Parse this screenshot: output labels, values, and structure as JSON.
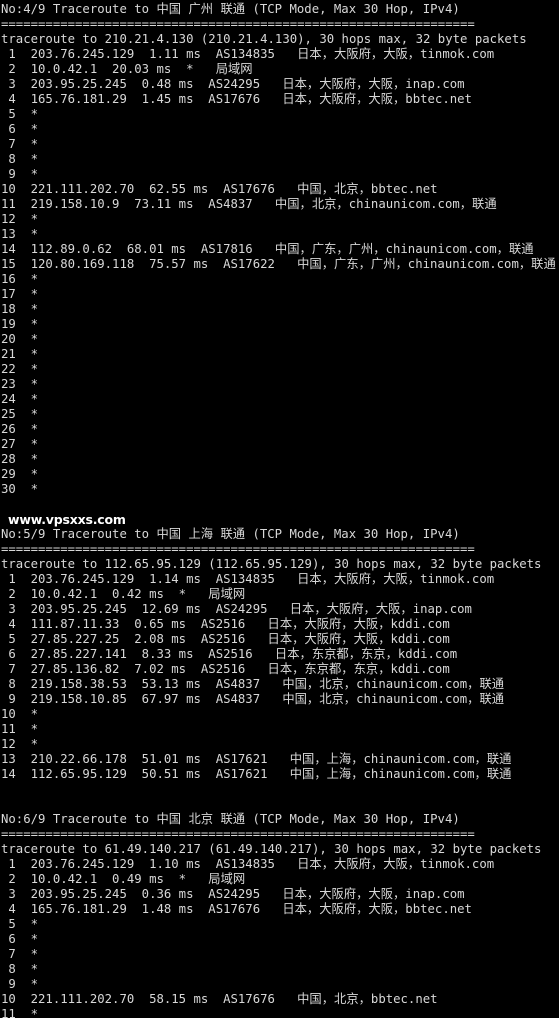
{
  "terminal": {
    "background_color": "#000000",
    "text_color": "#d8d8d8",
    "watermark": "www.vpsxxs.com",
    "separator": "================================================================"
  },
  "blocks": [
    {
      "header": "No:4/9 Traceroute to 中国 广州 联通 (TCP Mode, Max 30 Hop, IPv4)",
      "separator": "================================================================",
      "intro": "traceroute to 210.21.4.130 (210.21.4.130), 30 hops max, 32 byte packets",
      "hops": [
        " 1  203.76.245.129  1.11 ms  AS134835   日本，大阪府，大阪，tinmok.com",
        " 2  10.0.42.1  20.03 ms  *   局域网",
        " 3  203.95.25.245  0.48 ms  AS24295   日本，大阪府，大阪，inap.com",
        " 4  165.76.181.29  1.45 ms  AS17676   日本，大阪府，大阪，bbtec.net",
        " 5  *",
        " 6  *",
        " 7  *",
        " 8  *",
        " 9  *",
        "10  221.111.202.70  62.55 ms  AS17676   中国，北京，bbtec.net",
        "11  219.158.10.9  73.11 ms  AS4837   中国，北京，chinaunicom.com，联通",
        "12  *",
        "13  *",
        "14  112.89.0.62  68.01 ms  AS17816   中国，广东，广州，chinaunicom.com，联通",
        "15  120.80.169.118  75.57 ms  AS17622   中国，广东，广州，chinaunicom.com，联通",
        "16  *",
        "17  *",
        "18  *",
        "19  *",
        "20  *",
        "21  *",
        "22  *",
        "23  *",
        "24  *",
        "25  *",
        "26  *",
        "27  *",
        "28  *",
        "29  *",
        "30  *"
      ]
    },
    {
      "header": "No:5/9 Traceroute to 中国 上海 联通 (TCP Mode, Max 30 Hop, IPv4)",
      "separator": "================================================================",
      "intro": "traceroute to 112.65.95.129 (112.65.95.129), 30 hops max, 32 byte packets",
      "hops": [
        " 1  203.76.245.129  1.14 ms  AS134835   日本，大阪府，大阪，tinmok.com",
        " 2  10.0.42.1  0.42 ms  *   局域网",
        " 3  203.95.25.245  12.69 ms  AS24295   日本，大阪府，大阪，inap.com",
        " 4  111.87.11.33  0.65 ms  AS2516   日本，大阪府，大阪，kddi.com",
        " 5  27.85.227.25  2.08 ms  AS2516   日本，大阪府，大阪，kddi.com",
        " 6  27.85.227.141  8.33 ms  AS2516   日本，东京都，东京，kddi.com",
        " 7  27.85.136.82  7.02 ms  AS2516   日本，东京都，东京，kddi.com",
        " 8  219.158.38.53  53.13 ms  AS4837   中国，北京，chinaunicom.com，联通",
        " 9  219.158.10.85  67.97 ms  AS4837   中国，北京，chinaunicom.com，联通",
        "10  *",
        "11  *",
        "12  *",
        "13  210.22.66.178  51.01 ms  AS17621   中国，上海，chinaunicom.com，联通",
        "14  112.65.95.129  50.51 ms  AS17621   中国，上海，chinaunicom.com，联通"
      ]
    },
    {
      "header": "No:6/9 Traceroute to 中国 北京 联通 (TCP Mode, Max 30 Hop, IPv4)",
      "separator": "================================================================",
      "intro": "traceroute to 61.49.140.217 (61.49.140.217), 30 hops max, 32 byte packets",
      "hops": [
        " 1  203.76.245.129  1.10 ms  AS134835   日本，大阪府，大阪，tinmok.com",
        " 2  10.0.42.1  0.49 ms  *   局域网",
        " 3  203.95.25.245  0.36 ms  AS24295   日本，大阪府，大阪，inap.com",
        " 4  165.76.181.29  1.48 ms  AS17676   日本，大阪府，大阪，bbtec.net",
        " 5  *",
        " 6  *",
        " 7  *",
        " 8  *",
        " 9  *",
        "10  221.111.202.70  58.15 ms  AS17676   中国，北京，bbtec.net",
        "11  *"
      ]
    }
  ]
}
